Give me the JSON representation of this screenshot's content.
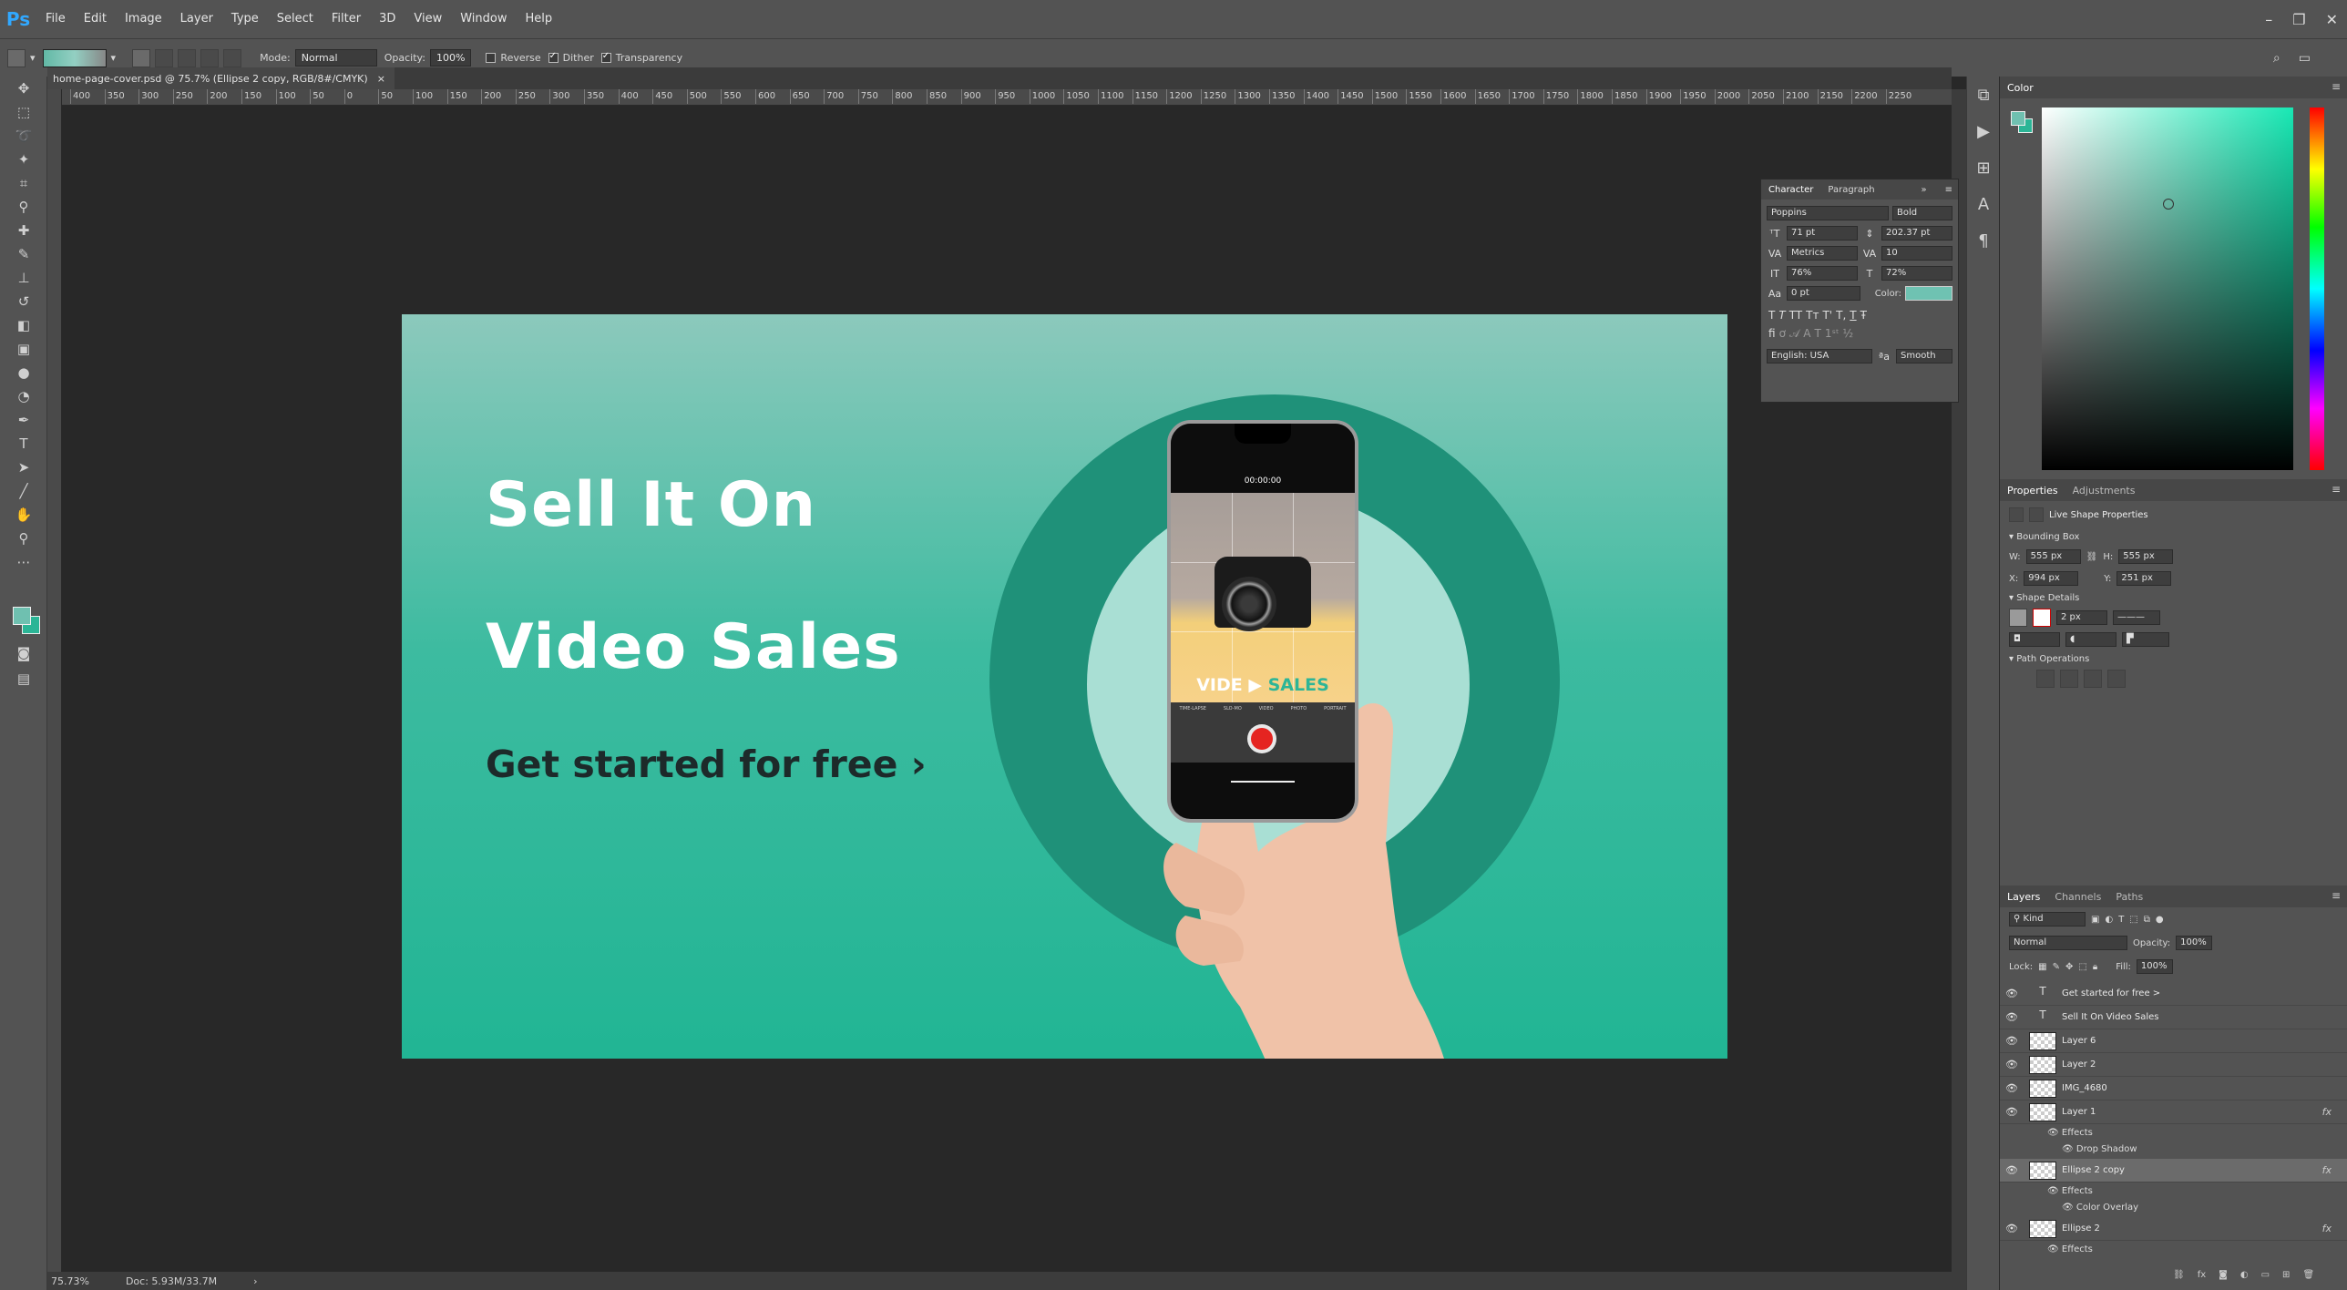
{
  "app": {
    "logo": "Ps"
  },
  "menu": [
    "File",
    "Edit",
    "Image",
    "Layer",
    "Type",
    "Select",
    "Filter",
    "3D",
    "View",
    "Window",
    "Help"
  ],
  "window_controls": [
    "–",
    "❐",
    "✕"
  ],
  "options": {
    "mode_label": "Mode:",
    "mode_value": "Normal",
    "opacity_label": "Opacity:",
    "opacity_value": "100%",
    "reverse_label": "Reverse",
    "dither_label": "Dither",
    "transparency_label": "Transparency"
  },
  "document": {
    "tab_title": "home-page-cover.psd @ 75.7% (Ellipse 2 copy, RGB/8#/CMYK)",
    "close": "×"
  },
  "ruler_ticks": [
    "400",
    "350",
    "300",
    "250",
    "200",
    "150",
    "100",
    "50",
    "0",
    "50",
    "100",
    "150",
    "200",
    "250",
    "300",
    "350",
    "400",
    "450",
    "500",
    "550",
    "600",
    "650",
    "700",
    "750",
    "800",
    "850",
    "900",
    "950",
    "1000",
    "1050",
    "1100",
    "1150",
    "1200",
    "1250",
    "1300",
    "1350",
    "1400",
    "1450",
    "1500",
    "1550",
    "1600",
    "1650",
    "1700",
    "1750",
    "1800",
    "1850",
    "1900",
    "1950",
    "2000",
    "2050",
    "2100",
    "2150",
    "2200",
    "2250"
  ],
  "artboard": {
    "headline_1": "Sell It On",
    "headline_2": "Video Sales",
    "cta": "Get started for free ›",
    "phone_time": "00:00:00",
    "phone_label_a": "VIDE",
    "phone_label_b": "SALES",
    "phone_modes": [
      "TIME-LAPSE",
      "SLO-MO",
      "VIDEO",
      "PHOTO",
      "PORTRAIT"
    ]
  },
  "status": {
    "zoom": "75.73%",
    "doc": "Doc: 5.93M/33.7M"
  },
  "character": {
    "tabs": [
      "Character",
      "Paragraph"
    ],
    "font_family": "Poppins",
    "font_style": "Bold",
    "size": "71 pt",
    "leading": "202.37 pt",
    "kerning": "Metrics",
    "tracking": "10",
    "v_scale": "76%",
    "h_scale": "72%",
    "baseline": "0 pt",
    "color_label": "Color:",
    "styles": [
      "T",
      "T",
      "TT",
      "Tт",
      "T'",
      "T,",
      "T",
      "Ŧ"
    ],
    "language": "English: USA",
    "antialias": "Smooth"
  },
  "color_panel": {
    "title": "Color"
  },
  "properties": {
    "tabs": [
      "Properties",
      "Adjustments"
    ],
    "live_shape_title": "Live Shape Properties",
    "bounding_box_title": "Bounding Box",
    "w_label": "W:",
    "w_value": "555 px",
    "h_label": "H:",
    "h_value": "555 px",
    "x_label": "X:",
    "x_value": "994 px",
    "y_label": "Y:",
    "y_value": "251 px",
    "shape_details_title": "Shape Details",
    "stroke_size": "2 px",
    "path_ops_title": "Path Operations"
  },
  "layers": {
    "tabs": [
      "Layers",
      "Channels",
      "Paths"
    ],
    "kind_label": "Kind",
    "blend_mode": "Normal",
    "opacity_label": "Opacity:",
    "opacity_value": "100%",
    "lock_label": "Lock:",
    "fill_label": "Fill:",
    "fill_value": "100%",
    "items": [
      {
        "name": "Get started for free >",
        "kind": "text",
        "fx": ""
      },
      {
        "name": "Sell It On Video Sales",
        "kind": "text",
        "fx": ""
      },
      {
        "name": "Layer 6",
        "kind": "pixel",
        "fx": ""
      },
      {
        "name": "Layer 2",
        "kind": "pixel",
        "fx": ""
      },
      {
        "name": "IMG_4680",
        "kind": "pixel",
        "fx": ""
      },
      {
        "name": "Layer 1",
        "kind": "pixel",
        "fx": "fx"
      },
      {
        "name": "Ellipse 2 copy",
        "kind": "shape",
        "fx": "fx"
      },
      {
        "name": "Ellipse 2",
        "kind": "shape",
        "fx": "fx"
      }
    ],
    "effects_label": "Effects",
    "drop_shadow": "Drop Shadow",
    "color_overlay": "Color Overlay"
  },
  "colors": {
    "accent_teal": "#2bb596",
    "record_red": "#e52421",
    "ui_gray": "#535353"
  }
}
